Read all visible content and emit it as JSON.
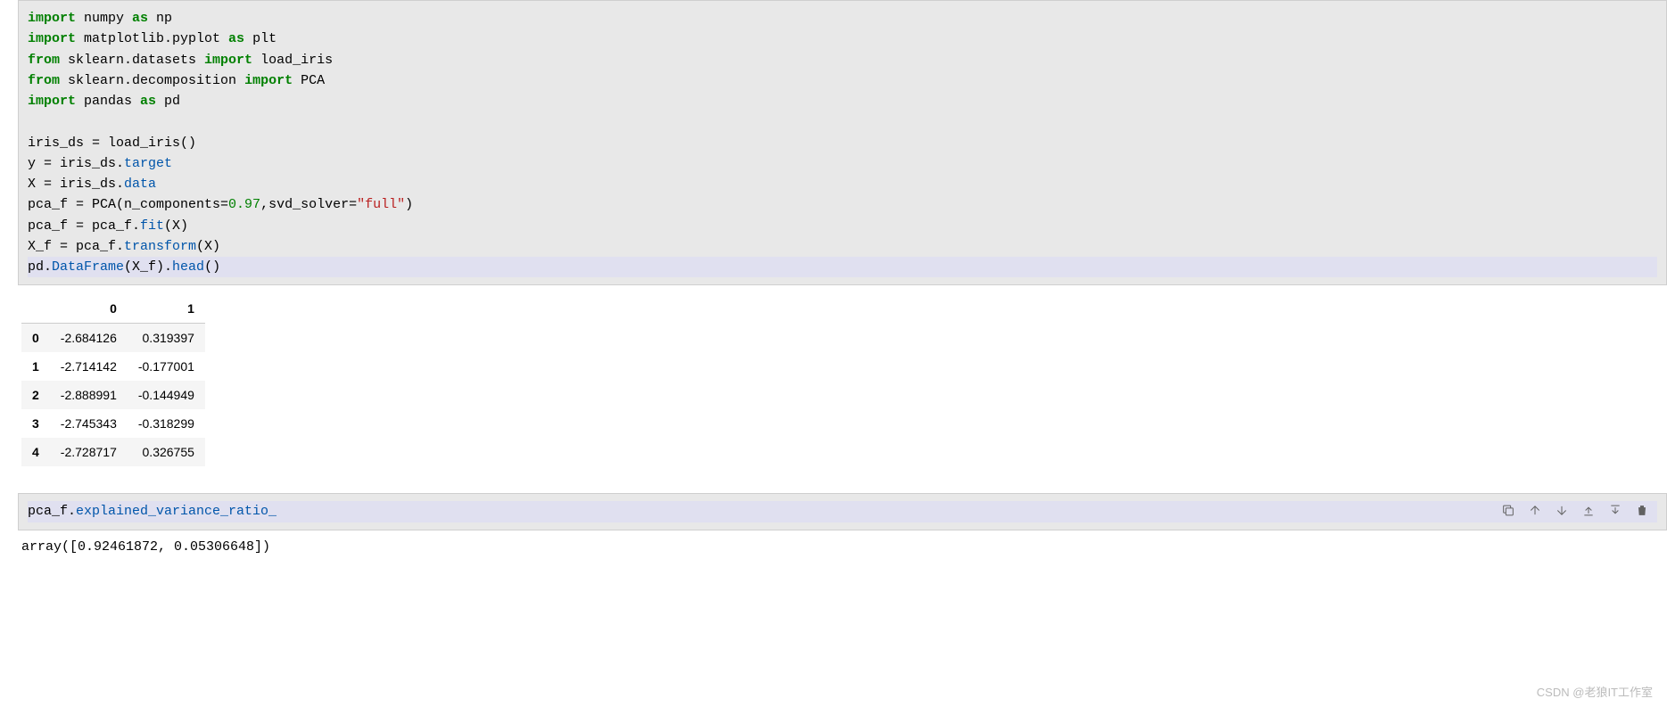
{
  "code_cell_1": {
    "lines": [
      {
        "tokens": [
          {
            "t": "import",
            "c": "kw-green"
          },
          {
            "t": " numpy "
          },
          {
            "t": "as",
            "c": "kw-green"
          },
          {
            "t": " np"
          }
        ]
      },
      {
        "tokens": [
          {
            "t": "import",
            "c": "kw-green"
          },
          {
            "t": " matplotlib.pyplot "
          },
          {
            "t": "as",
            "c": "kw-green"
          },
          {
            "t": " plt"
          }
        ]
      },
      {
        "tokens": [
          {
            "t": "from",
            "c": "kw-green"
          },
          {
            "t": " sklearn.datasets "
          },
          {
            "t": "import",
            "c": "kw-green"
          },
          {
            "t": " load_iris"
          }
        ]
      },
      {
        "tokens": [
          {
            "t": "from",
            "c": "kw-green"
          },
          {
            "t": " sklearn.decomposition "
          },
          {
            "t": "import",
            "c": "kw-green"
          },
          {
            "t": " PCA"
          }
        ]
      },
      {
        "tokens": [
          {
            "t": "import",
            "c": "kw-green"
          },
          {
            "t": " pandas "
          },
          {
            "t": "as",
            "c": "kw-green"
          },
          {
            "t": " pd"
          }
        ]
      },
      {
        "tokens": [
          {
            "t": " "
          }
        ]
      },
      {
        "tokens": [
          {
            "t": "iris_ds = load_iris()"
          }
        ]
      },
      {
        "tokens": [
          {
            "t": "y = iris_ds."
          },
          {
            "t": "target",
            "c": "attr"
          }
        ]
      },
      {
        "tokens": [
          {
            "t": "X = iris_ds."
          },
          {
            "t": "data",
            "c": "attr"
          }
        ]
      },
      {
        "tokens": [
          {
            "t": "pca_f = PCA(n_components="
          },
          {
            "t": "0.97",
            "c": "num"
          },
          {
            "t": ",svd_solver="
          },
          {
            "t": "\"full\"",
            "c": "str"
          },
          {
            "t": ")"
          }
        ]
      },
      {
        "tokens": [
          {
            "t": "pca_f = pca_f."
          },
          {
            "t": "fit",
            "c": "attr"
          },
          {
            "t": "(X)"
          }
        ]
      },
      {
        "tokens": [
          {
            "t": "X_f = pca_f."
          },
          {
            "t": "transform",
            "c": "attr"
          },
          {
            "t": "(X)"
          }
        ]
      },
      {
        "tokens": [
          {
            "t": "pd."
          },
          {
            "t": "DataFrame",
            "c": "attr"
          },
          {
            "t": "(X_f)."
          },
          {
            "t": "head",
            "c": "attr"
          },
          {
            "t": "()"
          }
        ],
        "selected": true
      }
    ]
  },
  "dataframe_output": {
    "columns": [
      "",
      "0",
      "1"
    ],
    "rows": [
      {
        "idx": "0",
        "vals": [
          "-2.684126",
          "0.319397"
        ]
      },
      {
        "idx": "1",
        "vals": [
          "-2.714142",
          "-0.177001"
        ]
      },
      {
        "idx": "2",
        "vals": [
          "-2.888991",
          "-0.144949"
        ]
      },
      {
        "idx": "3",
        "vals": [
          "-2.745343",
          "-0.318299"
        ]
      },
      {
        "idx": "4",
        "vals": [
          "-2.728717",
          "0.326755"
        ]
      }
    ]
  },
  "code_cell_2": {
    "lines": [
      {
        "tokens": [
          {
            "t": "pca_f."
          },
          {
            "t": "explained_variance_ratio_",
            "c": "attr"
          }
        ],
        "selected": true
      }
    ]
  },
  "text_output": "array([0.92461872, 0.05306648])",
  "watermark": "CSDN @老狼IT工作室",
  "toolbar": {
    "copy": "copy-icon",
    "up": "arrow-up-icon",
    "down": "arrow-down-icon",
    "run_above": "run-above-icon",
    "run_below": "run-below-icon",
    "delete": "trash-icon"
  }
}
